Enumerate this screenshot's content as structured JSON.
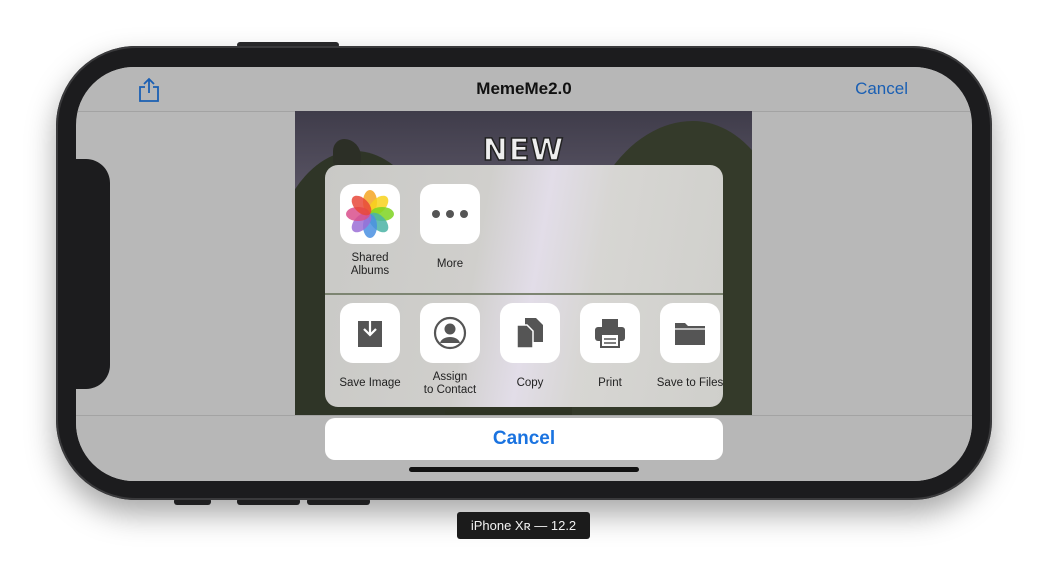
{
  "navbar": {
    "title": "MemeMe2.0",
    "cancel_label": "Cancel",
    "share_icon": "share-icon"
  },
  "meme": {
    "top_text": "NEW"
  },
  "share_sheet": {
    "top_row": [
      {
        "label": "Shared\nAlbums",
        "icon": "photos-icon"
      },
      {
        "label": "More",
        "icon": "more-icon"
      }
    ],
    "actions": [
      {
        "label": "Save Image",
        "icon": "save-image-icon"
      },
      {
        "label": "Assign\nto Contact",
        "icon": "contact-icon"
      },
      {
        "label": "Copy",
        "icon": "copy-icon"
      },
      {
        "label": "Print",
        "icon": "print-icon"
      },
      {
        "label": "Save to Files",
        "icon": "folder-icon"
      }
    ],
    "cancel_label": "Cancel"
  },
  "device_label": "iPhone Xʀ — 12.2",
  "colors": {
    "accent": "#1a73e0",
    "nav_accent": "#1a5fb3"
  }
}
